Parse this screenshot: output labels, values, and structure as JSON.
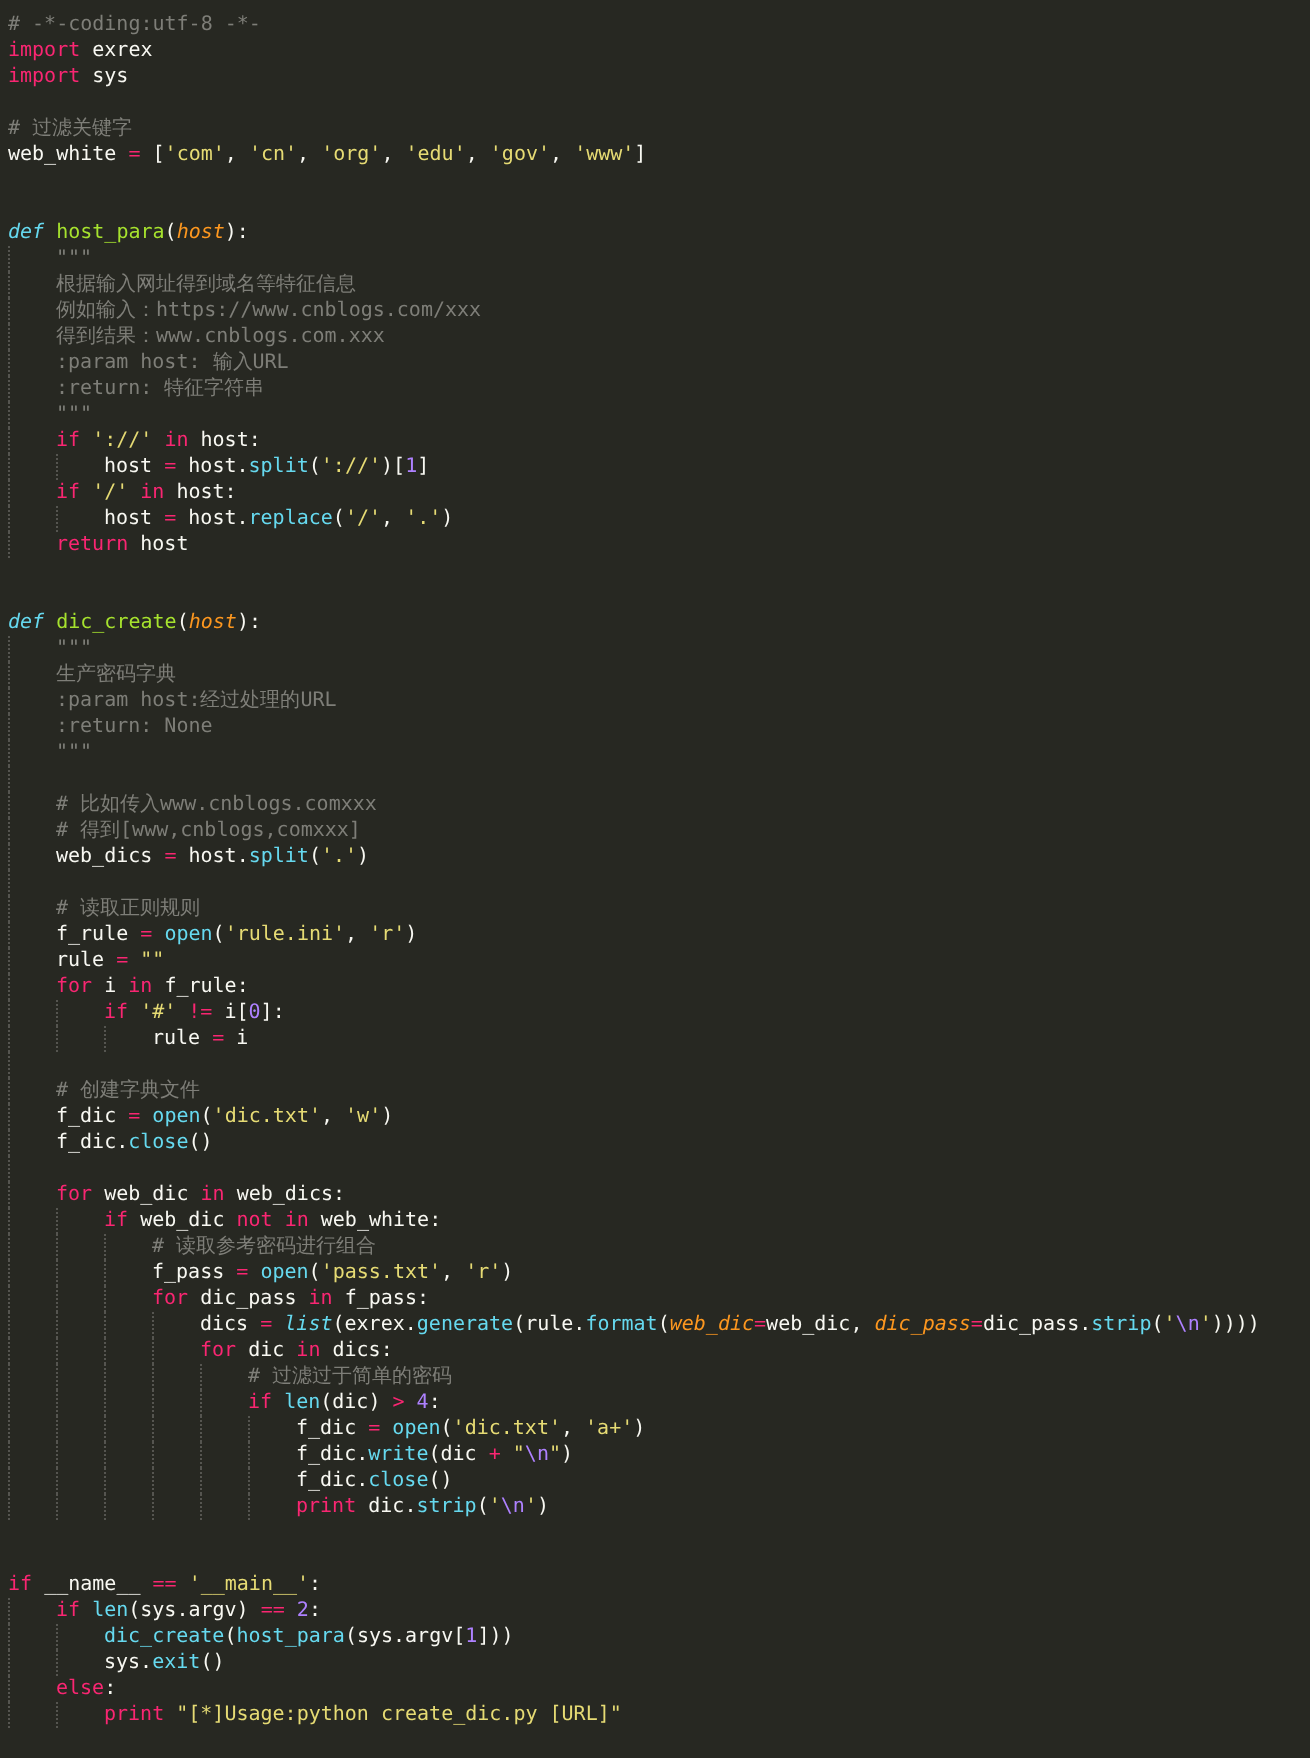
{
  "editor": {
    "lines": [
      {
        "kind": "code",
        "tokens": [
          {
            "kind": "comment",
            "text": "# -*-coding:utf-8 -*-"
          }
        ]
      },
      {
        "kind": "code",
        "tokens": [
          {
            "kind": "keyword",
            "text": "import"
          },
          {
            "kind": "plain",
            "text": " exrex"
          }
        ]
      },
      {
        "kind": "code",
        "tokens": [
          {
            "kind": "keyword",
            "text": "import"
          },
          {
            "kind": "plain",
            "text": " sys"
          }
        ]
      },
      {
        "kind": "blank"
      },
      {
        "kind": "code",
        "tokens": [
          {
            "kind": "comment",
            "text": "# 过滤关键字"
          }
        ]
      },
      {
        "kind": "code",
        "tokens": [
          {
            "kind": "plain",
            "text": "web_white "
          },
          {
            "kind": "op",
            "text": "="
          },
          {
            "kind": "plain",
            "text": " ["
          },
          {
            "kind": "string",
            "text": "'com'"
          },
          {
            "kind": "plain",
            "text": ", "
          },
          {
            "kind": "string",
            "text": "'cn'"
          },
          {
            "kind": "plain",
            "text": ", "
          },
          {
            "kind": "string",
            "text": "'org'"
          },
          {
            "kind": "plain",
            "text": ", "
          },
          {
            "kind": "string",
            "text": "'edu'"
          },
          {
            "kind": "plain",
            "text": ", "
          },
          {
            "kind": "string",
            "text": "'gov'"
          },
          {
            "kind": "plain",
            "text": ", "
          },
          {
            "kind": "string",
            "text": "'www'"
          },
          {
            "kind": "plain",
            "text": "]"
          }
        ]
      },
      {
        "kind": "blank"
      },
      {
        "kind": "blank"
      },
      {
        "kind": "code",
        "tokens": [
          {
            "kind": "storage",
            "text": "def "
          },
          {
            "kind": "func",
            "text": "host_para"
          },
          {
            "kind": "plain",
            "text": "("
          },
          {
            "kind": "param",
            "text": "host"
          },
          {
            "kind": "plain",
            "text": "):"
          }
        ],
        "children": [
          {
            "kind": "code",
            "tokens": [
              {
                "kind": "comment",
                "text": "\"\"\""
              }
            ]
          },
          {
            "kind": "code",
            "tokens": [
              {
                "kind": "comment",
                "text": "根据输入网址得到域名等特征信息"
              }
            ]
          },
          {
            "kind": "code",
            "tokens": [
              {
                "kind": "comment",
                "text": "例如输入：https://www.cnblogs.com/xxx"
              }
            ]
          },
          {
            "kind": "code",
            "tokens": [
              {
                "kind": "comment",
                "text": "得到结果：www.cnblogs.com.xxx"
              }
            ]
          },
          {
            "kind": "code",
            "tokens": [
              {
                "kind": "comment",
                "text": ":param host: 输入URL"
              }
            ]
          },
          {
            "kind": "code",
            "tokens": [
              {
                "kind": "comment",
                "text": ":return: 特征字符串"
              }
            ]
          },
          {
            "kind": "code",
            "tokens": [
              {
                "kind": "comment",
                "text": "\"\"\""
              }
            ]
          },
          {
            "kind": "code",
            "tokens": [
              {
                "kind": "keyword",
                "text": "if "
              },
              {
                "kind": "string",
                "text": "'://' "
              },
              {
                "kind": "keyword",
                "text": "in"
              },
              {
                "kind": "plain",
                "text": " host:"
              }
            ],
            "children": [
              {
                "kind": "code",
                "tokens": [
                  {
                    "kind": "plain",
                    "text": "host "
                  },
                  {
                    "kind": "op",
                    "text": "="
                  },
                  {
                    "kind": "plain",
                    "text": " host."
                  },
                  {
                    "kind": "call",
                    "text": "split"
                  },
                  {
                    "kind": "plain",
                    "text": "("
                  },
                  {
                    "kind": "string",
                    "text": "'://'"
                  },
                  {
                    "kind": "plain",
                    "text": ")["
                  },
                  {
                    "kind": "num",
                    "text": "1"
                  },
                  {
                    "kind": "plain",
                    "text": "]"
                  }
                ]
              }
            ]
          },
          {
            "kind": "code",
            "tokens": [
              {
                "kind": "keyword",
                "text": "if "
              },
              {
                "kind": "string",
                "text": "'/' "
              },
              {
                "kind": "keyword",
                "text": "in"
              },
              {
                "kind": "plain",
                "text": " host:"
              }
            ],
            "children": [
              {
                "kind": "code",
                "tokens": [
                  {
                    "kind": "plain",
                    "text": "host "
                  },
                  {
                    "kind": "op",
                    "text": "="
                  },
                  {
                    "kind": "plain",
                    "text": " host."
                  },
                  {
                    "kind": "call",
                    "text": "replace"
                  },
                  {
                    "kind": "plain",
                    "text": "("
                  },
                  {
                    "kind": "string",
                    "text": "'/'"
                  },
                  {
                    "kind": "plain",
                    "text": ", "
                  },
                  {
                    "kind": "string",
                    "text": "'.'"
                  },
                  {
                    "kind": "plain",
                    "text": ")"
                  }
                ]
              }
            ]
          },
          {
            "kind": "code",
            "tokens": [
              {
                "kind": "keyword",
                "text": "return"
              },
              {
                "kind": "plain",
                "text": " host"
              }
            ]
          }
        ]
      },
      {
        "kind": "blank"
      },
      {
        "kind": "blank"
      },
      {
        "kind": "code",
        "tokens": [
          {
            "kind": "storage",
            "text": "def "
          },
          {
            "kind": "func",
            "text": "dic_create"
          },
          {
            "kind": "plain",
            "text": "("
          },
          {
            "kind": "param",
            "text": "host"
          },
          {
            "kind": "plain",
            "text": "):"
          }
        ],
        "children": [
          {
            "kind": "code",
            "tokens": [
              {
                "kind": "comment",
                "text": "\"\"\""
              }
            ]
          },
          {
            "kind": "code",
            "tokens": [
              {
                "kind": "comment",
                "text": "生产密码字典"
              }
            ]
          },
          {
            "kind": "code",
            "tokens": [
              {
                "kind": "comment",
                "text": ":param host:经过处理的URL"
              }
            ]
          },
          {
            "kind": "code",
            "tokens": [
              {
                "kind": "comment",
                "text": ":return: None"
              }
            ]
          },
          {
            "kind": "code",
            "tokens": [
              {
                "kind": "comment",
                "text": "\"\"\""
              }
            ]
          },
          {
            "kind": "blank"
          },
          {
            "kind": "code",
            "tokens": [
              {
                "kind": "comment",
                "text": "# 比如传入www.cnblogs.comxxx"
              }
            ]
          },
          {
            "kind": "code",
            "tokens": [
              {
                "kind": "comment",
                "text": "# 得到[www,cnblogs,comxxx]"
              }
            ]
          },
          {
            "kind": "code",
            "tokens": [
              {
                "kind": "plain",
                "text": "web_dics "
              },
              {
                "kind": "op",
                "text": "="
              },
              {
                "kind": "plain",
                "text": " host."
              },
              {
                "kind": "call",
                "text": "split"
              },
              {
                "kind": "plain",
                "text": "("
              },
              {
                "kind": "string",
                "text": "'.'"
              },
              {
                "kind": "plain",
                "text": ")"
              }
            ]
          },
          {
            "kind": "blank"
          },
          {
            "kind": "code",
            "tokens": [
              {
                "kind": "comment",
                "text": "# 读取正则规则"
              }
            ]
          },
          {
            "kind": "code",
            "tokens": [
              {
                "kind": "plain",
                "text": "f_rule "
              },
              {
                "kind": "op",
                "text": "= "
              },
              {
                "kind": "call",
                "text": "open"
              },
              {
                "kind": "plain",
                "text": "("
              },
              {
                "kind": "string",
                "text": "'rule.ini'"
              },
              {
                "kind": "plain",
                "text": ", "
              },
              {
                "kind": "string",
                "text": "'r'"
              },
              {
                "kind": "plain",
                "text": ")"
              }
            ]
          },
          {
            "kind": "code",
            "tokens": [
              {
                "kind": "plain",
                "text": "rule "
              },
              {
                "kind": "op",
                "text": "= "
              },
              {
                "kind": "string",
                "text": "\"\""
              }
            ]
          },
          {
            "kind": "code",
            "tokens": [
              {
                "kind": "keyword",
                "text": "for"
              },
              {
                "kind": "plain",
                "text": " i "
              },
              {
                "kind": "keyword",
                "text": "in"
              },
              {
                "kind": "plain",
                "text": " f_rule:"
              }
            ],
            "children": [
              {
                "kind": "code",
                "tokens": [
                  {
                    "kind": "keyword",
                    "text": "if "
                  },
                  {
                    "kind": "string",
                    "text": "'#' "
                  },
                  {
                    "kind": "op",
                    "text": "!="
                  },
                  {
                    "kind": "plain",
                    "text": " i["
                  },
                  {
                    "kind": "num",
                    "text": "0"
                  },
                  {
                    "kind": "plain",
                    "text": "]:"
                  }
                ],
                "children": [
                  {
                    "kind": "code",
                    "tokens": [
                      {
                        "kind": "plain",
                        "text": "rule "
                      },
                      {
                        "kind": "op",
                        "text": "="
                      },
                      {
                        "kind": "plain",
                        "text": " i"
                      }
                    ]
                  }
                ]
              }
            ]
          },
          {
            "kind": "blank"
          },
          {
            "kind": "code",
            "tokens": [
              {
                "kind": "comment",
                "text": "# 创建字典文件"
              }
            ]
          },
          {
            "kind": "code",
            "tokens": [
              {
                "kind": "plain",
                "text": "f_dic "
              },
              {
                "kind": "op",
                "text": "= "
              },
              {
                "kind": "call",
                "text": "open"
              },
              {
                "kind": "plain",
                "text": "("
              },
              {
                "kind": "string",
                "text": "'dic.txt'"
              },
              {
                "kind": "plain",
                "text": ", "
              },
              {
                "kind": "string",
                "text": "'w'"
              },
              {
                "kind": "plain",
                "text": ")"
              }
            ]
          },
          {
            "kind": "code",
            "tokens": [
              {
                "kind": "plain",
                "text": "f_dic."
              },
              {
                "kind": "call",
                "text": "close"
              },
              {
                "kind": "plain",
                "text": "()"
              }
            ]
          },
          {
            "kind": "blank"
          },
          {
            "kind": "code",
            "tokens": [
              {
                "kind": "keyword",
                "text": "for"
              },
              {
                "kind": "plain",
                "text": " web_dic "
              },
              {
                "kind": "keyword",
                "text": "in"
              },
              {
                "kind": "plain",
                "text": " web_dics:"
              }
            ],
            "children": [
              {
                "kind": "code",
                "tokens": [
                  {
                    "kind": "keyword",
                    "text": "if"
                  },
                  {
                    "kind": "plain",
                    "text": " web_dic "
                  },
                  {
                    "kind": "keyword",
                    "text": "not in"
                  },
                  {
                    "kind": "plain",
                    "text": " web_white:"
                  }
                ],
                "children": [
                  {
                    "kind": "code",
                    "tokens": [
                      {
                        "kind": "comment",
                        "text": "# 读取参考密码进行组合"
                      }
                    ]
                  },
                  {
                    "kind": "code",
                    "tokens": [
                      {
                        "kind": "plain",
                        "text": "f_pass "
                      },
                      {
                        "kind": "op",
                        "text": "= "
                      },
                      {
                        "kind": "call",
                        "text": "open"
                      },
                      {
                        "kind": "plain",
                        "text": "("
                      },
                      {
                        "kind": "string",
                        "text": "'pass.txt'"
                      },
                      {
                        "kind": "plain",
                        "text": ", "
                      },
                      {
                        "kind": "string",
                        "text": "'r'"
                      },
                      {
                        "kind": "plain",
                        "text": ")"
                      }
                    ]
                  },
                  {
                    "kind": "code",
                    "tokens": [
                      {
                        "kind": "keyword",
                        "text": "for"
                      },
                      {
                        "kind": "plain",
                        "text": " dic_pass "
                      },
                      {
                        "kind": "keyword",
                        "text": "in"
                      },
                      {
                        "kind": "plain",
                        "text": " f_pass:"
                      }
                    ],
                    "children": [
                      {
                        "kind": "code",
                        "tokens": [
                          {
                            "kind": "plain",
                            "text": "dics "
                          },
                          {
                            "kind": "op",
                            "text": "= "
                          },
                          {
                            "kind": "builtin",
                            "text": "list"
                          },
                          {
                            "kind": "plain",
                            "text": "(exrex."
                          },
                          {
                            "kind": "call",
                            "text": "generate"
                          },
                          {
                            "kind": "plain",
                            "text": "(rule."
                          },
                          {
                            "kind": "call",
                            "text": "format"
                          },
                          {
                            "kind": "plain",
                            "text": "("
                          },
                          {
                            "kind": "param",
                            "text": "web_dic"
                          },
                          {
                            "kind": "op",
                            "text": "="
                          },
                          {
                            "kind": "plain",
                            "text": "web_dic, "
                          },
                          {
                            "kind": "param",
                            "text": "dic_pass"
                          },
                          {
                            "kind": "op",
                            "text": "="
                          },
                          {
                            "kind": "plain",
                            "text": "dic_pass."
                          },
                          {
                            "kind": "call",
                            "text": "strip"
                          },
                          {
                            "kind": "plain",
                            "text": "("
                          },
                          {
                            "kind": "string",
                            "text": "'"
                          },
                          {
                            "kind": "esc",
                            "text": "\\n"
                          },
                          {
                            "kind": "string",
                            "text": "'"
                          },
                          {
                            "kind": "plain",
                            "text": "))))"
                          }
                        ]
                      },
                      {
                        "kind": "code",
                        "tokens": [
                          {
                            "kind": "keyword",
                            "text": "for"
                          },
                          {
                            "kind": "plain",
                            "text": " dic "
                          },
                          {
                            "kind": "keyword",
                            "text": "in"
                          },
                          {
                            "kind": "plain",
                            "text": " dics:"
                          }
                        ],
                        "children": [
                          {
                            "kind": "code",
                            "tokens": [
                              {
                                "kind": "comment",
                                "text": "# 过滤过于简单的密码"
                              }
                            ]
                          },
                          {
                            "kind": "code",
                            "tokens": [
                              {
                                "kind": "keyword",
                                "text": "if "
                              },
                              {
                                "kind": "call",
                                "text": "len"
                              },
                              {
                                "kind": "plain",
                                "text": "(dic) "
                              },
                              {
                                "kind": "op",
                                "text": "> "
                              },
                              {
                                "kind": "num",
                                "text": "4"
                              },
                              {
                                "kind": "plain",
                                "text": ":"
                              }
                            ],
                            "children": [
                              {
                                "kind": "code",
                                "tokens": [
                                  {
                                    "kind": "plain",
                                    "text": "f_dic "
                                  },
                                  {
                                    "kind": "op",
                                    "text": "= "
                                  },
                                  {
                                    "kind": "call",
                                    "text": "open"
                                  },
                                  {
                                    "kind": "plain",
                                    "text": "("
                                  },
                                  {
                                    "kind": "string",
                                    "text": "'dic.txt'"
                                  },
                                  {
                                    "kind": "plain",
                                    "text": ", "
                                  },
                                  {
                                    "kind": "string",
                                    "text": "'a+'"
                                  },
                                  {
                                    "kind": "plain",
                                    "text": ")"
                                  }
                                ]
                              },
                              {
                                "kind": "code",
                                "tokens": [
                                  {
                                    "kind": "plain",
                                    "text": "f_dic."
                                  },
                                  {
                                    "kind": "call",
                                    "text": "write"
                                  },
                                  {
                                    "kind": "plain",
                                    "text": "(dic "
                                  },
                                  {
                                    "kind": "op",
                                    "text": "+ "
                                  },
                                  {
                                    "kind": "string",
                                    "text": "\""
                                  },
                                  {
                                    "kind": "esc",
                                    "text": "\\n"
                                  },
                                  {
                                    "kind": "string",
                                    "text": "\""
                                  },
                                  {
                                    "kind": "plain",
                                    "text": ")"
                                  }
                                ]
                              },
                              {
                                "kind": "code",
                                "tokens": [
                                  {
                                    "kind": "plain",
                                    "text": "f_dic."
                                  },
                                  {
                                    "kind": "call",
                                    "text": "close"
                                  },
                                  {
                                    "kind": "plain",
                                    "text": "()"
                                  }
                                ]
                              },
                              {
                                "kind": "code",
                                "tokens": [
                                  {
                                    "kind": "keyword",
                                    "text": "print"
                                  },
                                  {
                                    "kind": "plain",
                                    "text": " dic."
                                  },
                                  {
                                    "kind": "call",
                                    "text": "strip"
                                  },
                                  {
                                    "kind": "plain",
                                    "text": "("
                                  },
                                  {
                                    "kind": "string",
                                    "text": "'"
                                  },
                                  {
                                    "kind": "esc",
                                    "text": "\\n"
                                  },
                                  {
                                    "kind": "string",
                                    "text": "'"
                                  },
                                  {
                                    "kind": "plain",
                                    "text": ")"
                                  }
                                ]
                              }
                            ]
                          }
                        ]
                      }
                    ]
                  }
                ]
              }
            ]
          }
        ]
      },
      {
        "kind": "blank"
      },
      {
        "kind": "blank"
      },
      {
        "kind": "code",
        "tokens": [
          {
            "kind": "keyword",
            "text": "if"
          },
          {
            "kind": "plain",
            "text": " __name__ "
          },
          {
            "kind": "op",
            "text": "== "
          },
          {
            "kind": "string",
            "text": "'__main__'"
          },
          {
            "kind": "plain",
            "text": ":"
          }
        ],
        "children": [
          {
            "kind": "code",
            "tokens": [
              {
                "kind": "keyword",
                "text": "if "
              },
              {
                "kind": "call",
                "text": "len"
              },
              {
                "kind": "plain",
                "text": "(sys.argv) "
              },
              {
                "kind": "op",
                "text": "== "
              },
              {
                "kind": "num",
                "text": "2"
              },
              {
                "kind": "plain",
                "text": ":"
              }
            ],
            "children": [
              {
                "kind": "code",
                "tokens": [
                  {
                    "kind": "call",
                    "text": "dic_create"
                  },
                  {
                    "kind": "plain",
                    "text": "("
                  },
                  {
                    "kind": "call",
                    "text": "host_para"
                  },
                  {
                    "kind": "plain",
                    "text": "(sys.argv["
                  },
                  {
                    "kind": "num",
                    "text": "1"
                  },
                  {
                    "kind": "plain",
                    "text": "]))"
                  }
                ]
              },
              {
                "kind": "code",
                "tokens": [
                  {
                    "kind": "plain",
                    "text": "sys."
                  },
                  {
                    "kind": "call",
                    "text": "exit"
                  },
                  {
                    "kind": "plain",
                    "text": "()"
                  }
                ]
              }
            ]
          },
          {
            "kind": "code",
            "tokens": [
              {
                "kind": "keyword",
                "text": "else"
              },
              {
                "kind": "plain",
                "text": ":"
              }
            ],
            "children": [
              {
                "kind": "code",
                "tokens": [
                  {
                    "kind": "keyword",
                    "text": "print "
                  },
                  {
                    "kind": "string",
                    "text": "\"[*]Usage:python create_dic.py [URL]\""
                  }
                ]
              }
            ]
          }
        ]
      }
    ]
  }
}
